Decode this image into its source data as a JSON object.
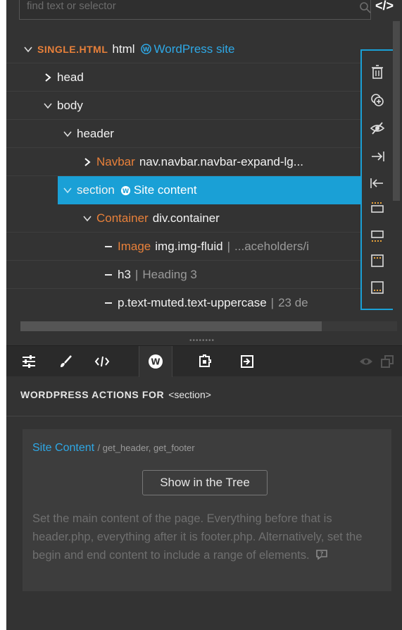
{
  "search": {
    "placeholder": "find text or selector"
  },
  "tree": {
    "root": {
      "tag": "SINGLE.HTML",
      "label": "html",
      "wp_label": "WordPress site"
    },
    "rows": {
      "head": "head",
      "body": "body",
      "header": "header",
      "navbar_tag": "Navbar",
      "navbar_label": "nav.navbar.navbar-expand-lg...",
      "section_label": "section",
      "section_wp": "Site content",
      "container_tag": "Container",
      "container_label": "div.container",
      "image_tag": "Image",
      "image_label": "img.img-fluid",
      "image_extra": "...aceholders/i",
      "h3_label": "h3",
      "h3_extra": "Heading 3",
      "p_label": "p.text-muted.text-uppercase",
      "p_extra": "23 de"
    }
  },
  "toolbar_icons": [
    "trash-icon",
    "duplicate-icon",
    "hide-icon",
    "indent-icon",
    "outdent-icon",
    "insert-before-icon",
    "insert-after-icon",
    "insert-inside-start-icon",
    "insert-inside-end-icon"
  ],
  "tabs": [
    "properties-icon",
    "style-icon",
    "code-icon",
    "wordpress-icon",
    "components-icon",
    "export-icon"
  ],
  "actions": {
    "title": "WORDPRESS ACTIONS FOR",
    "element": "<section>",
    "card_name": "Site Content",
    "card_fns": "/ get_header, get_footer",
    "show_button": "Show in the Tree",
    "description": "Set the main content of the page. Everything before that is header.php, everything after it is footer.php. Alternatively, set the begin and end content to include a range of elements."
  },
  "colors": {
    "accent": "#1aa0d6",
    "orange": "#e8803a",
    "panel": "#333333"
  }
}
